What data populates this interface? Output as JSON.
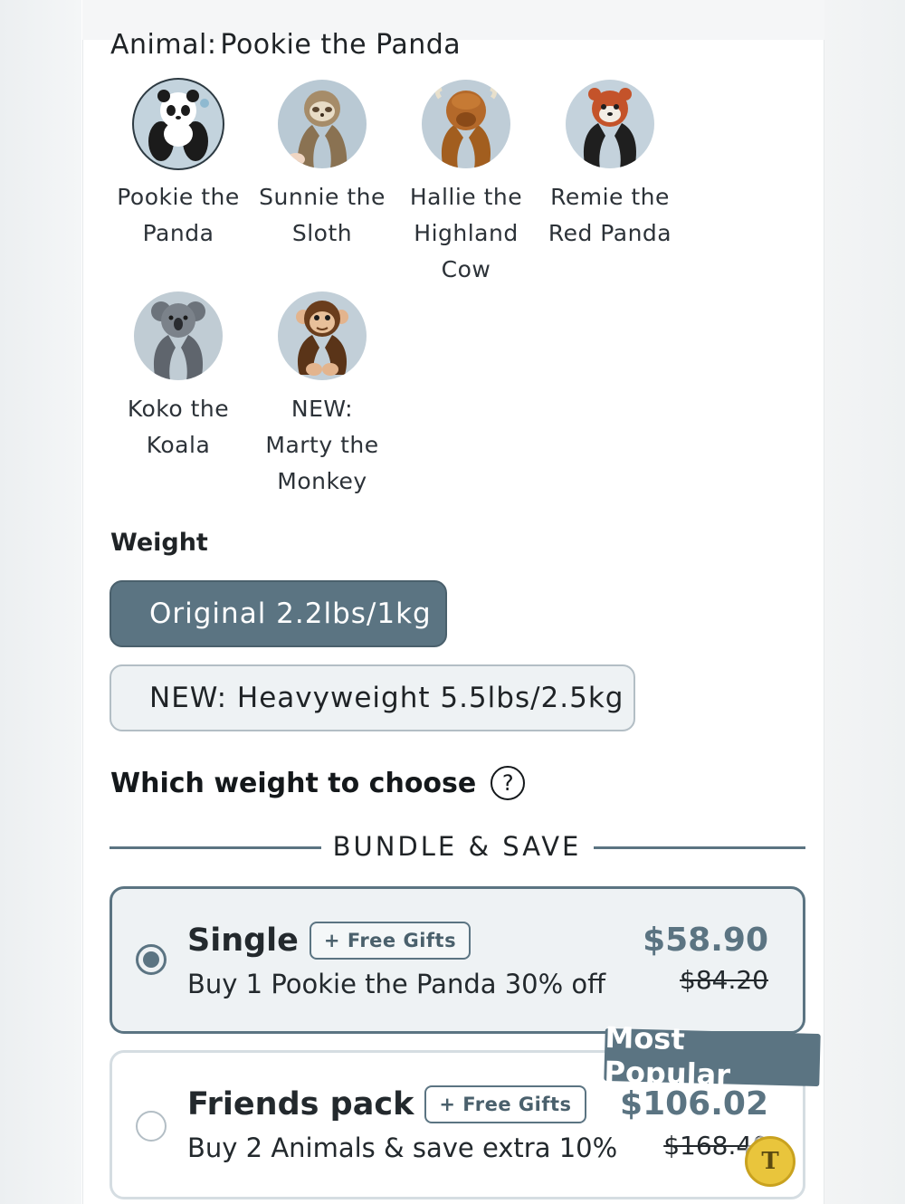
{
  "animal": {
    "label": "Animal:",
    "selected": "Pookie the Panda",
    "options": [
      {
        "name": "Pookie the Panda",
        "line1": "Pookie the",
        "line2": "Panda",
        "line3": "",
        "icon": "panda-plush-icon",
        "color": "#1e1e1e"
      },
      {
        "name": "Sunnie the Sloth",
        "line1": "Sunnie the",
        "line2": "Sloth",
        "line3": "",
        "icon": "sloth-plush-icon",
        "color": "#9c8360"
      },
      {
        "name": "Hallie the Highland Cow",
        "line1": "Hallie the",
        "line2": "Highland",
        "line3": "Cow",
        "icon": "highland-cow-plush-icon",
        "color": "#9a5a1e"
      },
      {
        "name": "Remie the Red Panda",
        "line1": "Remie the",
        "line2": "Red Panda",
        "line3": "",
        "icon": "red-panda-plush-icon",
        "color": "#2a2624"
      },
      {
        "name": "Koko the Koala",
        "line1": "Koko the",
        "line2": "Koala",
        "line3": "",
        "icon": "koala-plush-icon",
        "color": "#5e646c"
      },
      {
        "name": "NEW: Marty the Monkey",
        "line1": "NEW:",
        "line2": "Marty the",
        "line3": "Monkey",
        "icon": "monkey-plush-icon",
        "color": "#5a3418"
      }
    ]
  },
  "weight": {
    "label": "Weight",
    "options": [
      {
        "label": "Original 2.2lbs/1kg",
        "selected": true
      },
      {
        "label": "NEW: Heavyweight 5.5lbs/2.5kg",
        "selected": false
      }
    ],
    "help_link": "Which weight to choose",
    "help_icon": "?"
  },
  "bundle": {
    "title": "BUNDLE & SAVE",
    "offers": [
      {
        "title": "Single",
        "badge": "+ Free Gifts",
        "subtitle": "Buy 1 Pookie the Panda 30% off",
        "price": "$58.90",
        "old_price": "$84.20",
        "selected": true
      },
      {
        "title": "Friends pack",
        "badge": "+ Free Gifts",
        "subtitle": "Buy 2 Animals & save extra 10%",
        "price": "$106.02",
        "old_price": "$168.40",
        "selected": false,
        "tag": "Most Popular"
      }
    ]
  },
  "fab": {
    "glyph": "T",
    "icon": "translate-icon"
  },
  "colors": {
    "accent": "#5b7482",
    "accent_light": "#eef2f4",
    "border": "#b3bec5"
  }
}
